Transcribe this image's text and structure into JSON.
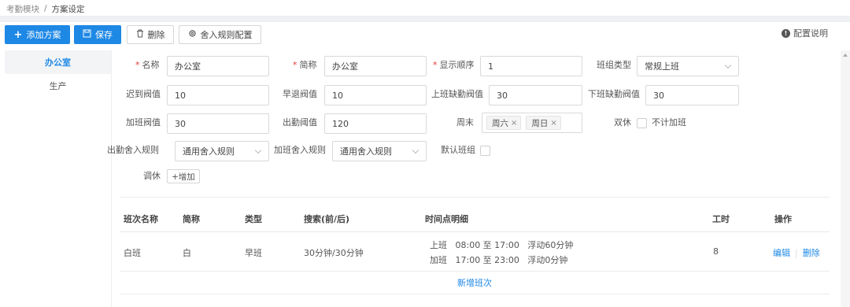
{
  "breadcrumb": {
    "parent": "考勤模块",
    "separator": "/",
    "current": "方案设定"
  },
  "toolbar": {
    "add_label": "添加方案",
    "save_label": "保存",
    "delete_label": "删除",
    "rounding_label": "舍入规则配置",
    "help_label": "配置说明"
  },
  "sidebar": {
    "items": [
      {
        "label": "办公室"
      },
      {
        "label": "生产"
      }
    ]
  },
  "form": {
    "name": {
      "label": "名称",
      "value": "办公室"
    },
    "short_name": {
      "label": "简称",
      "value": "办公室"
    },
    "display_order": {
      "label": "显示顺序",
      "value": "1"
    },
    "shift_type": {
      "label": "班组类型",
      "value": "常规上班"
    },
    "late_threshold": {
      "label": "迟到阀值",
      "value": "10"
    },
    "early_threshold": {
      "label": "早退阀值",
      "value": "10"
    },
    "in_absent_threshold": {
      "label": "上班缺勤阀值",
      "value": "30"
    },
    "out_absent_threshold": {
      "label": "下班缺勤阀值",
      "value": "30"
    },
    "overtime_threshold": {
      "label": "加班阀值",
      "value": "30"
    },
    "attendance_threshold": {
      "label": "出勤阈值",
      "value": "120"
    },
    "weekend": {
      "label": "周末",
      "tags": [
        "周六",
        "周日"
      ]
    },
    "double_rest": {
      "label": "双休",
      "option_label": "不计加班"
    },
    "attendance_rounding": {
      "label": "出勤舍入规则",
      "value": "通用舍入规则"
    },
    "overtime_rounding": {
      "label": "加班舍入规则",
      "value": "通用舍入规则"
    },
    "default_shift": {
      "label": "默认班组"
    },
    "adjust_rest": {
      "label": "调休",
      "button_label": "+增加"
    }
  },
  "table": {
    "headers": [
      "班次名称",
      "简称",
      "类型",
      "搜索(前/后)",
      "时间点明细",
      "工时",
      "操作"
    ],
    "rows": [
      {
        "name": "白班",
        "short": "白",
        "type": "早班",
        "search": "30分钟/30分钟",
        "detail_line1": "上班   08:00 至 17:00   浮动60分钟",
        "detail_line2": "加班   17:00 至 23:00   浮动0分钟",
        "hours": "8",
        "edit": "编辑",
        "delete": "删除"
      }
    ],
    "add_label": "新增班次"
  }
}
